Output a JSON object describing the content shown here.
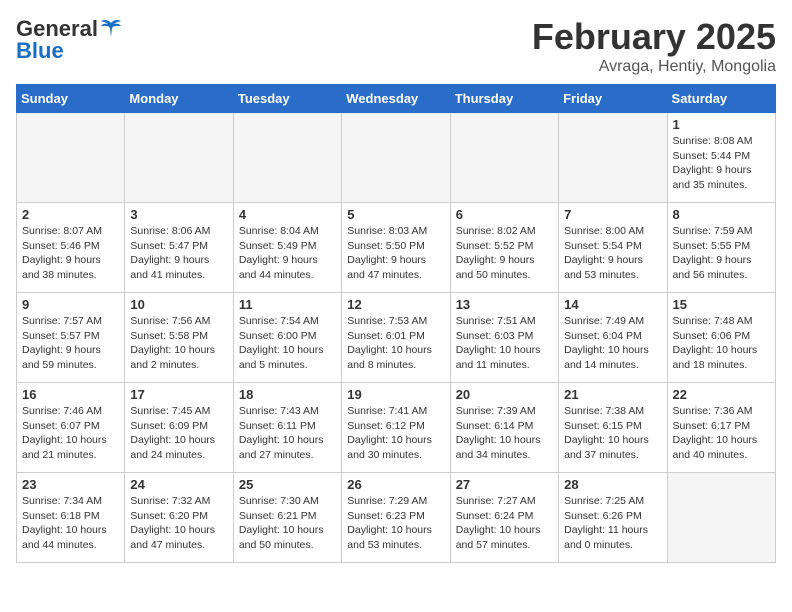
{
  "header": {
    "logo_general": "General",
    "logo_blue": "Blue",
    "title": "February 2025",
    "subtitle": "Avraga, Hentiy, Mongolia"
  },
  "weekdays": [
    "Sunday",
    "Monday",
    "Tuesday",
    "Wednesday",
    "Thursday",
    "Friday",
    "Saturday"
  ],
  "weeks": [
    [
      {
        "day": "",
        "info": ""
      },
      {
        "day": "",
        "info": ""
      },
      {
        "day": "",
        "info": ""
      },
      {
        "day": "",
        "info": ""
      },
      {
        "day": "",
        "info": ""
      },
      {
        "day": "",
        "info": ""
      },
      {
        "day": "1",
        "info": "Sunrise: 8:08 AM\nSunset: 5:44 PM\nDaylight: 9 hours and 35 minutes."
      }
    ],
    [
      {
        "day": "2",
        "info": "Sunrise: 8:07 AM\nSunset: 5:46 PM\nDaylight: 9 hours and 38 minutes."
      },
      {
        "day": "3",
        "info": "Sunrise: 8:06 AM\nSunset: 5:47 PM\nDaylight: 9 hours and 41 minutes."
      },
      {
        "day": "4",
        "info": "Sunrise: 8:04 AM\nSunset: 5:49 PM\nDaylight: 9 hours and 44 minutes."
      },
      {
        "day": "5",
        "info": "Sunrise: 8:03 AM\nSunset: 5:50 PM\nDaylight: 9 hours and 47 minutes."
      },
      {
        "day": "6",
        "info": "Sunrise: 8:02 AM\nSunset: 5:52 PM\nDaylight: 9 hours and 50 minutes."
      },
      {
        "day": "7",
        "info": "Sunrise: 8:00 AM\nSunset: 5:54 PM\nDaylight: 9 hours and 53 minutes."
      },
      {
        "day": "8",
        "info": "Sunrise: 7:59 AM\nSunset: 5:55 PM\nDaylight: 9 hours and 56 minutes."
      }
    ],
    [
      {
        "day": "9",
        "info": "Sunrise: 7:57 AM\nSunset: 5:57 PM\nDaylight: 9 hours and 59 minutes."
      },
      {
        "day": "10",
        "info": "Sunrise: 7:56 AM\nSunset: 5:58 PM\nDaylight: 10 hours and 2 minutes."
      },
      {
        "day": "11",
        "info": "Sunrise: 7:54 AM\nSunset: 6:00 PM\nDaylight: 10 hours and 5 minutes."
      },
      {
        "day": "12",
        "info": "Sunrise: 7:53 AM\nSunset: 6:01 PM\nDaylight: 10 hours and 8 minutes."
      },
      {
        "day": "13",
        "info": "Sunrise: 7:51 AM\nSunset: 6:03 PM\nDaylight: 10 hours and 11 minutes."
      },
      {
        "day": "14",
        "info": "Sunrise: 7:49 AM\nSunset: 6:04 PM\nDaylight: 10 hours and 14 minutes."
      },
      {
        "day": "15",
        "info": "Sunrise: 7:48 AM\nSunset: 6:06 PM\nDaylight: 10 hours and 18 minutes."
      }
    ],
    [
      {
        "day": "16",
        "info": "Sunrise: 7:46 AM\nSunset: 6:07 PM\nDaylight: 10 hours and 21 minutes."
      },
      {
        "day": "17",
        "info": "Sunrise: 7:45 AM\nSunset: 6:09 PM\nDaylight: 10 hours and 24 minutes."
      },
      {
        "day": "18",
        "info": "Sunrise: 7:43 AM\nSunset: 6:11 PM\nDaylight: 10 hours and 27 minutes."
      },
      {
        "day": "19",
        "info": "Sunrise: 7:41 AM\nSunset: 6:12 PM\nDaylight: 10 hours and 30 minutes."
      },
      {
        "day": "20",
        "info": "Sunrise: 7:39 AM\nSunset: 6:14 PM\nDaylight: 10 hours and 34 minutes."
      },
      {
        "day": "21",
        "info": "Sunrise: 7:38 AM\nSunset: 6:15 PM\nDaylight: 10 hours and 37 minutes."
      },
      {
        "day": "22",
        "info": "Sunrise: 7:36 AM\nSunset: 6:17 PM\nDaylight: 10 hours and 40 minutes."
      }
    ],
    [
      {
        "day": "23",
        "info": "Sunrise: 7:34 AM\nSunset: 6:18 PM\nDaylight: 10 hours and 44 minutes."
      },
      {
        "day": "24",
        "info": "Sunrise: 7:32 AM\nSunset: 6:20 PM\nDaylight: 10 hours and 47 minutes."
      },
      {
        "day": "25",
        "info": "Sunrise: 7:30 AM\nSunset: 6:21 PM\nDaylight: 10 hours and 50 minutes."
      },
      {
        "day": "26",
        "info": "Sunrise: 7:29 AM\nSunset: 6:23 PM\nDaylight: 10 hours and 53 minutes."
      },
      {
        "day": "27",
        "info": "Sunrise: 7:27 AM\nSunset: 6:24 PM\nDaylight: 10 hours and 57 minutes."
      },
      {
        "day": "28",
        "info": "Sunrise: 7:25 AM\nSunset: 6:26 PM\nDaylight: 11 hours and 0 minutes."
      },
      {
        "day": "",
        "info": ""
      }
    ]
  ]
}
